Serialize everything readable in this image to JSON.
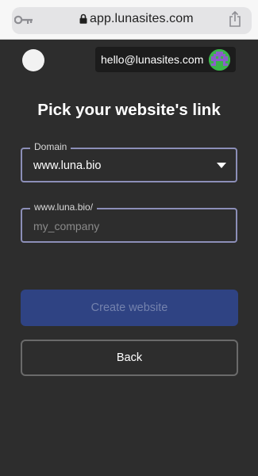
{
  "browser": {
    "url": "app.lunasites.com",
    "icons": {
      "password": "key-icon",
      "secure": "lock-icon",
      "share": "share-icon"
    }
  },
  "header": {
    "account_email": "hello@lunasites.com",
    "avatar_icon": "pixel-avatar-icon"
  },
  "form": {
    "title": "Pick your website's link",
    "domain": {
      "label": "Domain",
      "selected": "www.luna.bio"
    },
    "path": {
      "label": "www.luna.bio/",
      "placeholder": "my_company",
      "value": ""
    }
  },
  "actions": {
    "create_label": "Create website",
    "back_label": "Back"
  },
  "colors": {
    "background": "#2d2d2d",
    "field_border": "#8c8fb8",
    "primary_button": "#2f4383",
    "primary_button_text": "#7482ad"
  }
}
